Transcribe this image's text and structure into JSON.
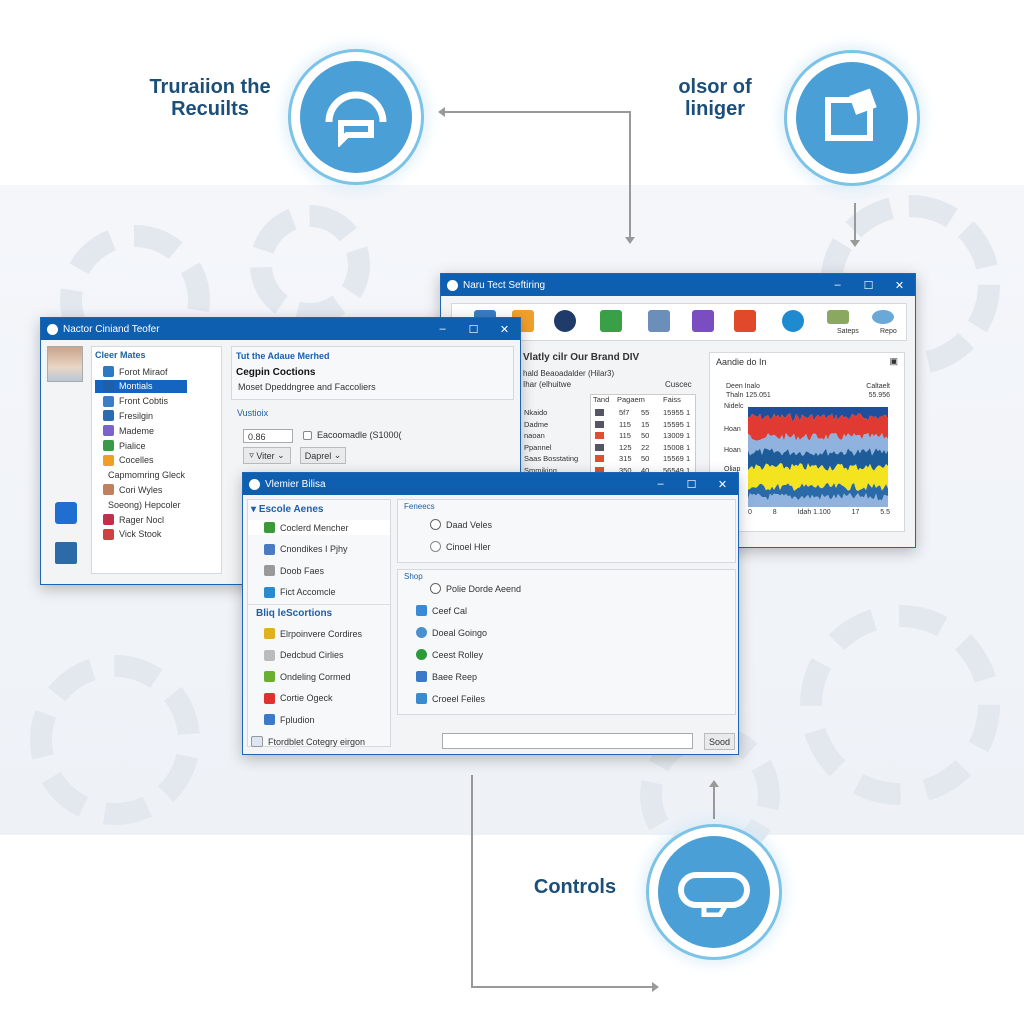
{
  "callouts": {
    "top_left": "Truraiion the\nRecuilts",
    "top_right": "olsor of\nliniger",
    "bottom": "Controls"
  },
  "window1": {
    "title": "Nactor Ciniand Teofer",
    "list_title": "Cleer Mates",
    "list": [
      "Forot Miraof",
      "Montials",
      "Front Cobtis",
      "Fresilgin",
      "Mademe",
      "Pialice",
      "Cocelles",
      "Capmomring Gleck",
      "Cori Wyles",
      "Soeong) Hepcoler",
      "Rager Nocl",
      "Vick Stook"
    ],
    "selected_index": 1,
    "section_title": "Tut the Adaue Merhed",
    "subtitle": "Cegpin Coctions",
    "description": "Moset Dpeddngree and Faccoliers",
    "group_label": "Vustioix",
    "input_value": "0.86",
    "checkbox_label": "Eacoomadle (S1000(",
    "filter_button": "Viter",
    "panel_button": "Daprel"
  },
  "window2": {
    "title": "Naru Tect Seftiring",
    "toolbar_labels": [
      "Sateps",
      "Repo"
    ],
    "heading": "Vlatly cilr Our Brand DIV",
    "line1": "hald Beaoadalder (Hilar3)",
    "line2": "Ihar (elhuitwe",
    "col_label": "Cuscec",
    "table_headers": [
      "Tand",
      "Pagaem",
      "",
      "Faiss"
    ],
    "rows": [
      {
        "name": "Nkaido",
        "a": "5f7",
        "b": "55",
        "c": "15955 1"
      },
      {
        "name": "Dadme",
        "a": "115",
        "b": "15",
        "c": "15595 1"
      },
      {
        "name": "naoan",
        "a": "115",
        "b": "50",
        "c": "13009 1"
      },
      {
        "name": "Ppannel",
        "a": "125",
        "b": "22",
        "c": "15008 1"
      },
      {
        "name": "Saas Bosstating",
        "a": "315",
        "b": "50",
        "c": "15569 1"
      },
      {
        "name": "Smmiking",
        "a": "350",
        "b": "40",
        "c": "56549 1"
      }
    ],
    "chart": {
      "title": "Aandie do In",
      "tl1": "Deen Inalo",
      "tl2": "Thaln 125.051",
      "tr1": "Caltaelt",
      "tr2": "55.956",
      "ylabels": [
        "Nidelc",
        "Hoan",
        "Hoan",
        "Oliap"
      ],
      "xlabels": [
        "0",
        "8",
        "Idah 1.100",
        "17",
        "5.5"
      ],
      "band_colors": [
        "#1f4e9c",
        "#e03a32",
        "#8fb2de",
        "#1d5c99",
        "#f3e41f",
        "#2a6aa8",
        "#8fb2de"
      ]
    }
  },
  "window3": {
    "title": "Vlemier Bilisa",
    "group1": "Escole Aenes",
    "group1_items": [
      "Coclerd Mencher",
      "Cnondikes I Pjhy",
      "Doob Faes",
      "Fict Accomcle"
    ],
    "group2": "Bliq leScortions",
    "group2_items": [
      "Elrpoinvere Cordires",
      "Dedcbud Cirlies",
      "Ondeling Cormed",
      "Cortie Ogeck",
      "Fpludion"
    ],
    "frame1": "Feneecs",
    "radios": [
      "Daad Veles",
      "Cinoel Hler"
    ],
    "frame2": "Shop",
    "shop_radio": "Polie Dorde Aeend",
    "shop_items": [
      "Ceef Cal",
      "Doeal Goingo",
      "Ceest Rolley",
      "Baee Reep",
      "Croeel Feiles"
    ],
    "footer_label": "Ftordblet Cotegry eirgon",
    "footer_input": "",
    "send_button": "Sood"
  }
}
